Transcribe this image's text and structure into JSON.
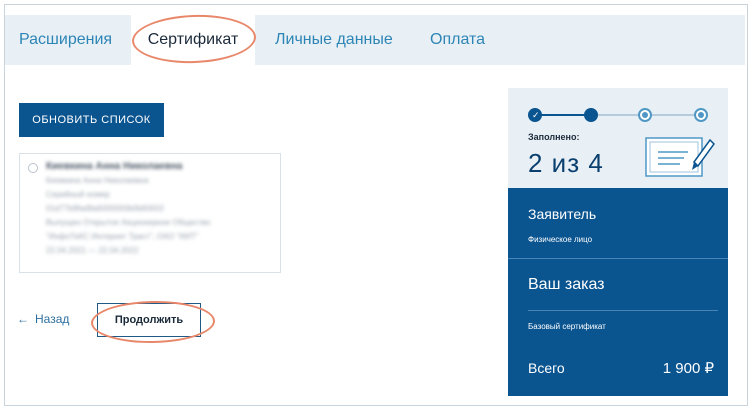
{
  "tabs": [
    {
      "label": "Расширения"
    },
    {
      "label": "Сертификат"
    },
    {
      "label": "Личные данные"
    },
    {
      "label": "Оплата"
    }
  ],
  "refresh_button": "ОБНОВИТЬ СПИСОК",
  "certificate": {
    "lines": [
      "Киевкина Анна Николаевна",
      "Киевкина Анна Николаевна",
      "Серийный номер",
      "01d77b9fad9a6000000b0b60002",
      "Выпущен Открытое Акционерное Общество",
      "\"ИнфоТеКС Интернет Траст\", ОАО \"ИИТ\"",
      "22.04.2021 — 22.04.2022"
    ]
  },
  "navigation": {
    "back_arrow": "←",
    "back": "Назад",
    "continue": "Продолжить"
  },
  "progress": {
    "label": "Заполнено:",
    "text": "2 из 4",
    "completed_steps": 2,
    "total_steps": 4,
    "check_glyph": "✓"
  },
  "summary": {
    "applicant_title": "Заявитель",
    "applicant_value": "Физическое лицо",
    "order_title": "Ваш заказ",
    "order_item": "Базовый сертификат",
    "total_label": "Всего",
    "total_value": "1 900 ₽"
  },
  "colors": {
    "primary": "#0a5490",
    "tab_bar": "#e8f0f6",
    "highlight": "#e8876a"
  }
}
